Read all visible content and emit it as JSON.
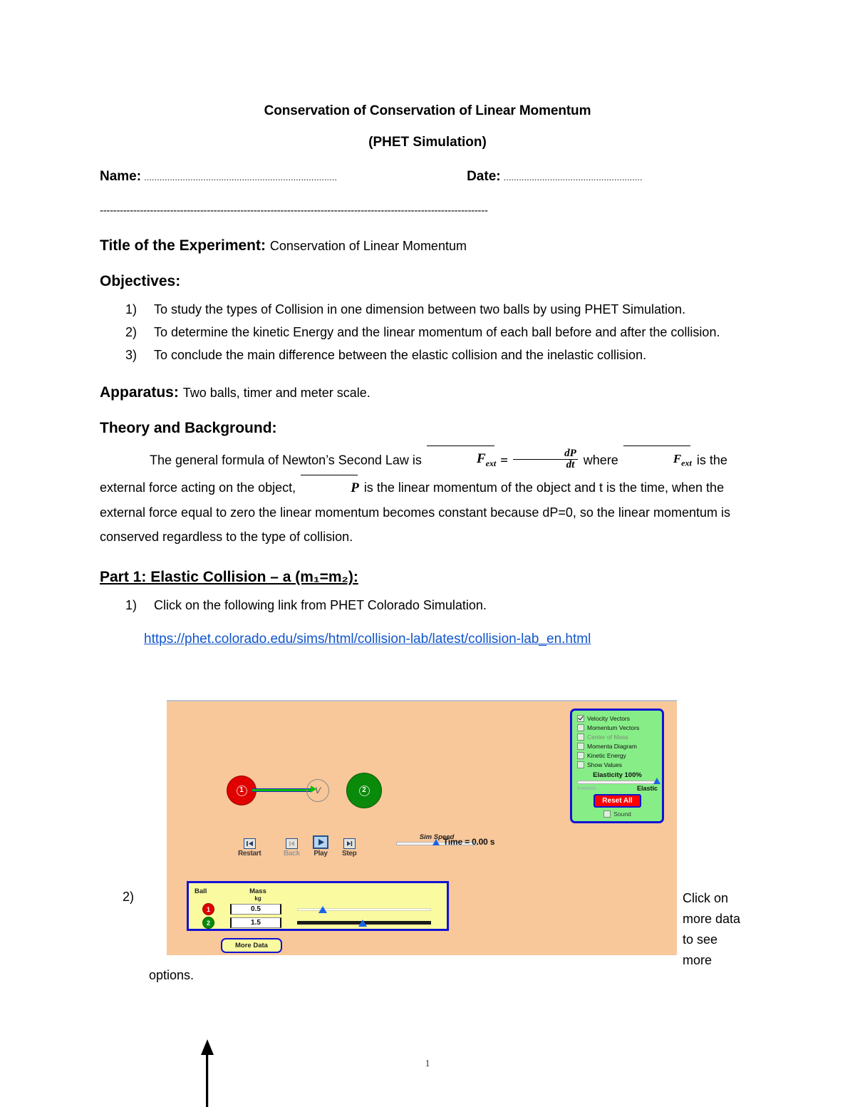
{
  "document": {
    "title": "Conservation of Conservation of Linear Momentum",
    "subtitle": "(PHET Simulation)",
    "name_label": "Name:",
    "date_label": "Date:",
    "name_dots": "...........................................................................",
    "date_dots": "......................................................",
    "horizontal_rule": "--------------------------------------------------------------------------------------------------------------------",
    "page_number": "1"
  },
  "sections": {
    "experiment_title_label": "Title of the Experiment:",
    "experiment_title_value": "Conservation of Linear Momentum",
    "objectives_heading": "Objectives:",
    "objectives": [
      "To study the types of Collision in one dimension between two balls by using PHET Simulation.",
      "To determine the kinetic Energy and the linear momentum of each ball before and after the collision.",
      "To conclude the main difference between the elastic collision and the inelastic collision."
    ],
    "apparatus_label": "Apparatus:",
    "apparatus_value": "Two balls, timer and meter scale.",
    "theory_heading": "Theory and Background:",
    "theory_part1": "The general formula of Newton’s Second Law is",
    "theory_part2": "where",
    "theory_part3": "is the external force acting on the object,",
    "theory_part4": "is the linear momentum of the object and t is the time, when the external force equal to zero the linear momentum becomes constant because dP=0, so the linear momentum is conserved regardless to the type of collision.",
    "formula": {
      "lhs": "F",
      "lhs_sub": "ext",
      "equals": "=",
      "numerator": "dP",
      "denominator": "dt",
      "rhs_symbol": "F",
      "rhs_sub": "ext",
      "momentum_symbol": "P"
    },
    "part1_heading": "Part 1: Elastic Collision – a (m₁=m₂):",
    "part1_steps": [
      "Click on the following link from PHET Colorado Simulation."
    ],
    "link_text": "https://phet.colorado.edu/sims/html/collision-lab/latest/collision-lab_en.html",
    "step2_marker": "2)",
    "step2_text_lines": [
      "Click on",
      "more data",
      "to see",
      "more"
    ],
    "step2_text_tail": "options."
  },
  "simulation": {
    "background_color": "#F8C79A",
    "balls": [
      {
        "label": "1",
        "color": "#E00000",
        "diameter": 42
      },
      {
        "label": "2",
        "color": "#0A8A0A",
        "diameter": 50
      }
    ],
    "velocity_vector": {
      "label": "V",
      "color": "#00C000",
      "outline_color": "#2222CC"
    },
    "control_panel": {
      "background_color": "#87EE87",
      "border_color": "#1212D4",
      "checkboxes": [
        {
          "label": "Velocity Vectors",
          "checked": true,
          "dim": false
        },
        {
          "label": "Momentum Vectors",
          "checked": false,
          "dim": false
        },
        {
          "label": "Center of Mass",
          "checked": false,
          "dim": true
        },
        {
          "label": "Momenta Diagram",
          "checked": false,
          "dim": false
        },
        {
          "label": "Kinetic Energy",
          "checked": false,
          "dim": false
        },
        {
          "label": "Show Values",
          "checked": false,
          "dim": false
        }
      ],
      "elasticity_label": "Elasticity 100%",
      "elasticity_min_label": "Inelastic",
      "elasticity_max_label": "Elastic",
      "elasticity_percent": 100,
      "reset_button": "Reset All",
      "sound_label": "Sound",
      "sound_checked": false
    },
    "playback": {
      "restart_label": "Restart",
      "back_label": "Back",
      "play_label": "Play",
      "step_label": "Step",
      "active": "Play"
    },
    "sim_speed_label": "Sim Speed",
    "sim_speed_percent": 50,
    "time_display": "Time = 0.00 s",
    "mass_panel": {
      "background_color": "#FAFAA0",
      "border_color": "#1212D4",
      "col_ball": "Ball",
      "col_mass": "Mass",
      "mass_unit": "kg",
      "rows": [
        {
          "ball": "1",
          "color": "#E00000",
          "mass": "0.5",
          "slider_percent": 18
        },
        {
          "ball": "2",
          "color": "#0A8A0A",
          "mass": "1.5",
          "slider_percent": 48
        }
      ],
      "more_data_button": "More Data"
    }
  }
}
